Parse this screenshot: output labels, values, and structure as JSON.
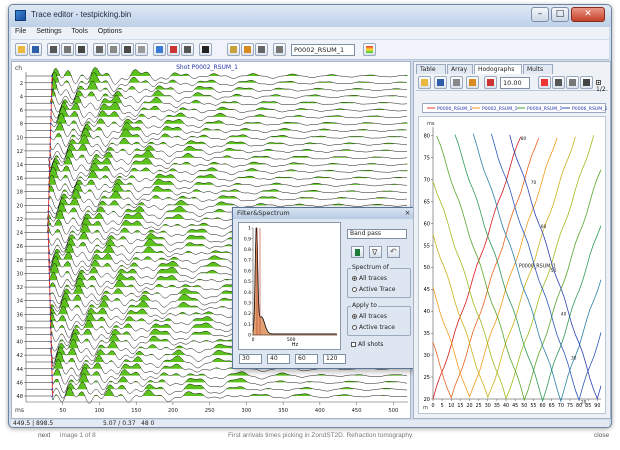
{
  "window": {
    "title": "Trace editor - testpicking.bin",
    "minimize": "–",
    "maximize": "□",
    "close": "✕"
  },
  "menu": [
    "File",
    "Settings",
    "Tools",
    "Options"
  ],
  "toolbar": {
    "trace_select": "P0002_RSUM_1"
  },
  "seismogram": {
    "title": "Shot P0002_RSUM_1",
    "ch_label": "ch",
    "ms_label": "ms",
    "channels": [
      "2",
      "4",
      "6",
      "8",
      "10",
      "12",
      "14",
      "16",
      "18",
      "20",
      "22",
      "24",
      "26",
      "28",
      "30",
      "32",
      "34",
      "36",
      "38",
      "40",
      "42",
      "44",
      "46",
      "48"
    ],
    "time_ticks": [
      "50",
      "100",
      "150",
      "200",
      "250",
      "300",
      "350",
      "400",
      "450",
      "500"
    ],
    "colors": {
      "fill": "#5bc21c",
      "trace": "#000000",
      "pick": "#e0261b"
    }
  },
  "dialog": {
    "title": "Filter&Spectrum",
    "close": "×",
    "filter_type": "Band pass",
    "spectrum_y_ticks": [
      "1",
      "0.9",
      "0.8",
      "0.7",
      "0.6",
      "0.5",
      "0.4",
      "0.3",
      "0.2",
      "0.1",
      "0"
    ],
    "spectrum_x_ticks": [
      "0",
      "500"
    ],
    "spectrum_x_label": "Hz",
    "spectrum_of_label": "Spectrum of",
    "spectrum_of_options": [
      "All traces",
      "Active Trace"
    ],
    "apply_to_label": "Apply to",
    "apply_to_options": [
      "All traces",
      "Active trace"
    ],
    "all_shots_label": "All shots",
    "freq_inputs": [
      "30",
      "40",
      "60",
      "120"
    ]
  },
  "right": {
    "tabs": [
      "Table",
      "Array",
      "Hodographs",
      "Mults"
    ],
    "zoom_value": "10.00",
    "half_label": "1/2",
    "legend": [
      "P0000_RSUM_1",
      "P0002_RSUM_1",
      "P0004_RSUM_1",
      "P0006_RSUM_1"
    ],
    "y_ticks": [
      "20",
      "25",
      "30",
      "35",
      "40",
      "45",
      "50",
      "55",
      "60",
      "65",
      "70",
      "75",
      "80"
    ],
    "x_ticks": [
      "0",
      "5",
      "10",
      "15",
      "20",
      "25",
      "30",
      "35",
      "40",
      "45",
      "50",
      "55",
      "60",
      "65",
      "70",
      "75",
      "80",
      "85",
      "90"
    ],
    "y_unit": "ms",
    "x_unit": "m",
    "curve_label": "P0000_RSUM_1",
    "point_labels": [
      "80",
      "70",
      "60",
      "50",
      "40",
      "30",
      "20"
    ]
  },
  "status": {
    "coords": "449.5 | 898.5",
    "value": "5.07 / 0.37",
    "extra": "48 0"
  },
  "caption": {
    "nav_next": "next",
    "image_counter": "image 1 of 8",
    "text": "First arrivals times picking in ZondST2D. Refraction tomography.",
    "close": "close"
  }
}
